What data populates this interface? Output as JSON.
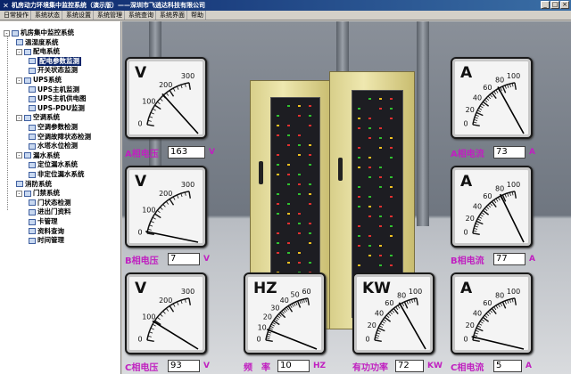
{
  "window": {
    "title": "机房动力环境集中监控系统（演示版）——深圳市飞逍达科技有限公司",
    "icon": "app-icon",
    "buttons": [
      "_",
      "□",
      "×"
    ]
  },
  "menu": [
    "日常操作",
    "系统状态",
    "系统设置",
    "系统管理",
    "系统查询",
    "系统界面",
    "帮助"
  ],
  "tree": [
    {
      "label": "机房集中监控系统",
      "level": 0,
      "box": "-"
    },
    {
      "label": "温湿度系统",
      "level": 1,
      "box": ""
    },
    {
      "label": "配电系统",
      "level": 1,
      "box": "-"
    },
    {
      "label": "配电参数监测",
      "level": 2,
      "box": "",
      "selected": true
    },
    {
      "label": "开关状态监测",
      "level": 2,
      "box": ""
    },
    {
      "label": "UPS系统",
      "level": 1,
      "box": "-"
    },
    {
      "label": "UPS主机监测",
      "level": 2,
      "box": ""
    },
    {
      "label": "UPS主机供电图",
      "level": 2,
      "box": ""
    },
    {
      "label": "UPS-PDU监测",
      "level": 2,
      "box": ""
    },
    {
      "label": "空调系统",
      "level": 1,
      "box": "-"
    },
    {
      "label": "空调参数检测",
      "level": 2,
      "box": ""
    },
    {
      "label": "空调故障状态检测",
      "level": 2,
      "box": ""
    },
    {
      "label": "水塔水位检测",
      "level": 2,
      "box": ""
    },
    {
      "label": "漏水系统",
      "level": 1,
      "box": "-"
    },
    {
      "label": "定位漏水系统",
      "level": 2,
      "box": ""
    },
    {
      "label": "非定位漏水系统",
      "level": 2,
      "box": ""
    },
    {
      "label": "消防系统",
      "level": 1,
      "box": ""
    },
    {
      "label": "门禁系统",
      "level": 1,
      "box": "-"
    },
    {
      "label": "门状态检测",
      "level": 2,
      "box": ""
    },
    {
      "label": "进出门资料",
      "level": 2,
      "box": ""
    },
    {
      "label": "卡管理",
      "level": 2,
      "box": ""
    },
    {
      "label": "资料查询",
      "level": 2,
      "box": ""
    },
    {
      "label": "时间管理",
      "level": 2,
      "box": ""
    }
  ],
  "gauges": [
    {
      "id": "a-voltage",
      "unit": "V",
      "ticks": [
        "0",
        "100",
        "200",
        "300"
      ],
      "max": 300,
      "value": 163,
      "label": "A相电压",
      "value_text": "163",
      "value_unit": "V"
    },
    {
      "id": "a-current",
      "unit": "A",
      "ticks": [
        "0",
        "20",
        "40",
        "60",
        "80",
        "100"
      ],
      "max": 100,
      "value": 73,
      "label": "A相电流",
      "value_text": "73",
      "value_unit": "A"
    },
    {
      "id": "b-voltage",
      "unit": "V",
      "ticks": [
        "0",
        "100",
        "200",
        "300"
      ],
      "max": 300,
      "value": 7,
      "label": "B相电压",
      "value_text": "7",
      "value_unit": "V"
    },
    {
      "id": "b-current",
      "unit": "A",
      "ticks": [
        "0",
        "20",
        "40",
        "60",
        "80",
        "100"
      ],
      "max": 100,
      "value": 77,
      "label": "B相电流",
      "value_text": "77",
      "value_unit": "A"
    },
    {
      "id": "c-voltage",
      "unit": "V",
      "ticks": [
        "0",
        "100",
        "200",
        "300"
      ],
      "max": 300,
      "value": 93,
      "label": "C相电压",
      "value_text": "93",
      "value_unit": "V"
    },
    {
      "id": "frequency",
      "unit": "HZ",
      "ticks": [
        "0",
        "10",
        "20",
        "30",
        "40",
        "50",
        "60"
      ],
      "max": 60,
      "value": 10,
      "label": "频　率",
      "value_text": "10",
      "value_unit": "HZ"
    },
    {
      "id": "active-power",
      "unit": "KW",
      "ticks": [
        "0",
        "20",
        "40",
        "60",
        "80",
        "100"
      ],
      "max": 100,
      "value": 72,
      "label": "有功功率",
      "value_text": "72",
      "value_unit": "KW"
    },
    {
      "id": "c-current",
      "unit": "A",
      "ticks": [
        "0",
        "20",
        "40",
        "60",
        "80",
        "100"
      ],
      "max": 100,
      "value": 5,
      "label": "C相电流",
      "value_text": "5",
      "value_unit": "A"
    }
  ],
  "colors": {
    "label": "#c020c0",
    "titlebar": "#0a246a",
    "cabinet": "#e2d99a"
  }
}
